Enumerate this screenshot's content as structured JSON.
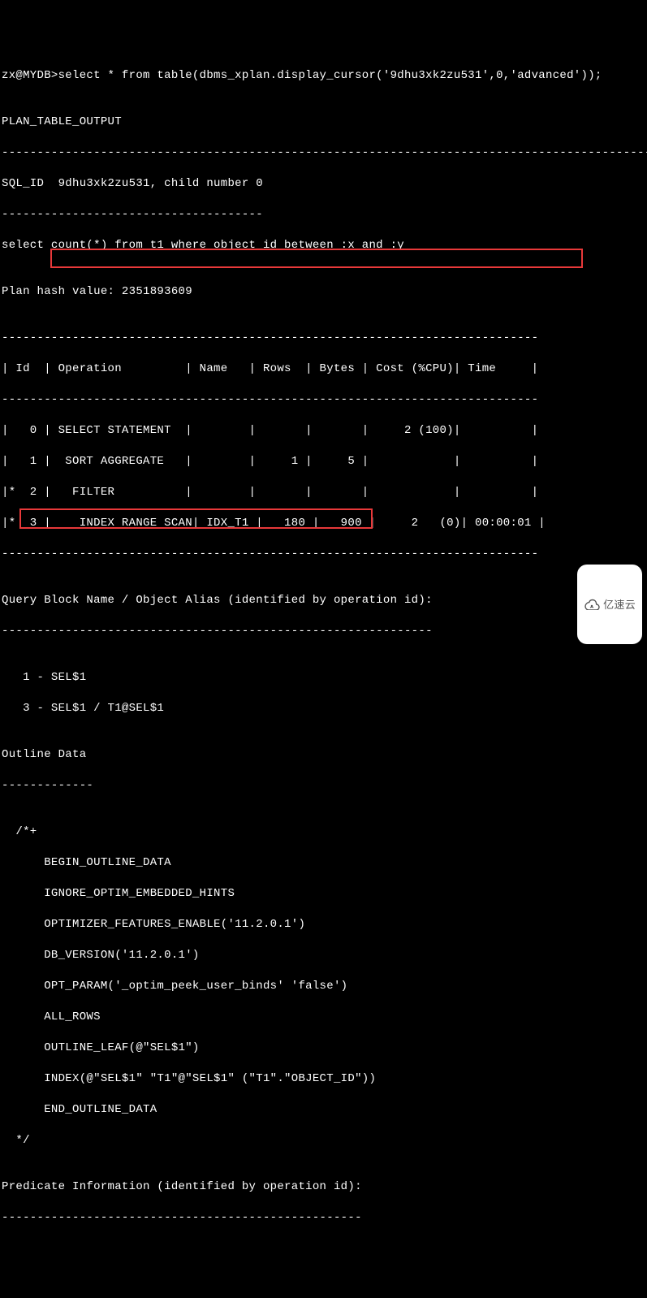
{
  "lines": {
    "l0": "zx@MYDB>select * from table(dbms_xplan.display_cursor('9dhu3xk2zu531',0,'advanced'));",
    "l1": "",
    "l2": "PLAN_TABLE_OUTPUT",
    "l3": "---------------------------------------------------------------------------------------------",
    "l4": "SQL_ID  9dhu3xk2zu531, child number 0",
    "l5": "-------------------------------------",
    "l6": "select count(*) from t1 where object_id between :x and :y",
    "l7": "",
    "l8": "Plan hash value: 2351893609",
    "l9": "",
    "l10": "----------------------------------------------------------------------------",
    "l11": "| Id  | Operation         | Name   | Rows  | Bytes | Cost (%CPU)| Time     |",
    "l12": "----------------------------------------------------------------------------",
    "l13": "|   0 | SELECT STATEMENT  |        |       |       |     2 (100)|          |",
    "l14": "|   1 |  SORT AGGREGATE   |        |     1 |     5 |            |          |",
    "l15": "|*  2 |   FILTER          |        |       |       |            |          |",
    "l16": "|*  3 |    INDEX RANGE SCAN| IDX_T1 |   180 |   900 |     2   (0)| 00:00:01 |",
    "l17": "----------------------------------------------------------------------------",
    "l18": "",
    "l19": "Query Block Name / Object Alias (identified by operation id):",
    "l20": "-------------------------------------------------------------",
    "l21": "",
    "l22": "   1 - SEL$1",
    "l23": "   3 - SEL$1 / T1@SEL$1",
    "l24": "",
    "l25": "Outline Data",
    "l26": "-------------",
    "l27": "",
    "l28": "  /*+",
    "l29": "      BEGIN_OUTLINE_DATA",
    "l30": "      IGNORE_OPTIM_EMBEDDED_HINTS",
    "l31": "      OPTIMIZER_FEATURES_ENABLE('11.2.0.1')",
    "l32": "      DB_VERSION('11.2.0.1')",
    "l33": "      OPT_PARAM('_optim_peek_user_binds' 'false')",
    "l34": "      ALL_ROWS",
    "l35": "      OUTLINE_LEAF(@\"SEL$1\")",
    "l36": "      INDEX(@\"SEL$1\" \"T1\"@\"SEL$1\" (\"T1\".\"OBJECT_ID\"))",
    "l37": "      END_OUTLINE_DATA",
    "l38": "  */",
    "l39": "",
    "l40": "Predicate Information (identified by operation id):",
    "l41": "---------------------------------------------------"
  },
  "watermark": {
    "text": "亿速云"
  }
}
